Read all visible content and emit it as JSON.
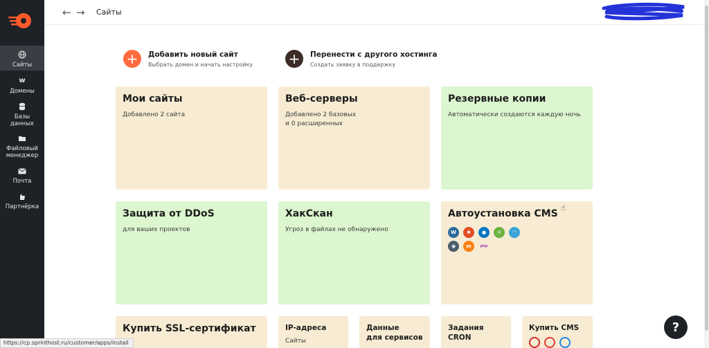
{
  "sidebar": {
    "items": [
      {
        "label": "Сайты",
        "icon": "globe-icon"
      },
      {
        "label": "Домены",
        "icon": "domain-w-icon"
      },
      {
        "label": "Базы\nданных",
        "icon": "database-icon"
      },
      {
        "label": "Файловый\nменеджер",
        "icon": "folder-icon"
      },
      {
        "label": "Почта",
        "icon": "mail-icon"
      },
      {
        "label": "Партнёрка",
        "icon": "partner-icon"
      }
    ]
  },
  "header": {
    "back": "←",
    "forward": "→",
    "title": "Сайты"
  },
  "actions": [
    {
      "title": "Добавить новый сайт",
      "subtitle": "Выбрать домен и начать настройку",
      "color": "#ff6b3d"
    },
    {
      "title": "Перенести с другого хостинга",
      "subtitle": "Создать заявку в поддержку",
      "color": "#3d2b28"
    }
  ],
  "cards": [
    {
      "title": "Мои сайты",
      "sub": "Добавлено 2 сайта"
    },
    {
      "title": "Веб-серверы",
      "sub": "Добавлено 2 базовых\nи 0 расширенных"
    },
    {
      "title": "Резервные копии",
      "sub": "Автоматически создаются каждую ночь"
    },
    {
      "title": "Защита от DDoS",
      "sub": "для ваших проектов"
    },
    {
      "title": "ХакСкан",
      "sub": "Угроз в файлах не обнаружено"
    },
    {
      "title": "Автоустановка CMS",
      "sub": ""
    },
    {
      "title": "Купить SSL-сертификат",
      "sub": ""
    },
    {
      "title": "IP-адреса",
      "sub": "Сайты"
    },
    {
      "title": "Данные\nдля сервисов",
      "sub": ""
    },
    {
      "title": "Задания\nCRON",
      "sub": ""
    },
    {
      "title": "Купить CMS",
      "sub": ""
    }
  ],
  "cms_icons": [
    {
      "name": "wordpress-icon",
      "color": "#2e6b9c",
      "glyph": "W"
    },
    {
      "name": "joomla-icon",
      "color": "#e44d26",
      "glyph": "✱"
    },
    {
      "name": "drupal-icon",
      "color": "#0677c3",
      "glyph": "●"
    },
    {
      "name": "modx-icon",
      "color": "#6cb33f",
      "glyph": "✕"
    },
    {
      "name": "opencart-icon",
      "color": "#3aa3d8",
      "glyph": "◠"
    },
    {
      "name": "prestashop-icon",
      "color": "#4a5c6b",
      "glyph": "◉"
    },
    {
      "name": "moodle-icon",
      "color": "#f98012",
      "glyph": "m"
    },
    {
      "name": "phpbb-icon",
      "color": "#9a3fb3",
      "glyph": "php"
    }
  ],
  "buy_cms_icons": [
    {
      "name": "1c-bitrix-icon",
      "color": "#d22a2a"
    },
    {
      "name": "umi-icon",
      "color": "#e53935"
    },
    {
      "name": "butterfly-icon",
      "color": "#1e88e5"
    }
  ],
  "help_label": "?",
  "status_url": "https://cp.sprinthost.ru/customer/apps/install",
  "colors": {
    "sidebar": "#1e2126",
    "beige": "#f7ecd3",
    "green": "#dcf6cf",
    "accent": "#ff6b3d"
  }
}
